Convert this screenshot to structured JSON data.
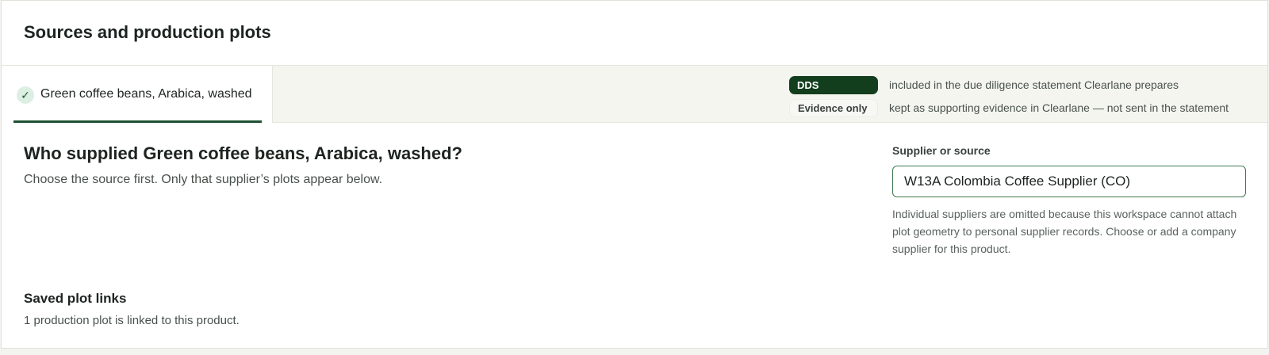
{
  "header": {
    "title": "Sources and production plots"
  },
  "product_tab": {
    "label": "Green coffee beans, Arabica, washed",
    "completed": true,
    "check_glyph": "✓"
  },
  "legend": {
    "dds": {
      "label": "DDS",
      "description": "included in the due diligence statement Clearlane prepares"
    },
    "evidence": {
      "label": "Evidence only",
      "description": "kept as supporting evidence in Clearlane — not sent in the statement"
    }
  },
  "source_section": {
    "question": "Who supplied Green coffee beans, Arabica, washed?",
    "hint": "Choose the source first. Only that supplier’s plots appear below.",
    "field_label": "Supplier or source",
    "field_value": "W13A Colombia Coffee Supplier (CO)",
    "help_text": "Individual suppliers are omitted because this workspace cannot attach plot geometry to personal supplier records. Choose or add a company supplier for this product."
  },
  "saved_links": {
    "title": "Saved plot links",
    "summary": "1 production plot is linked to this product."
  },
  "colors": {
    "accent_dark_green": "#133e1d",
    "tab_underline": "#1d5130",
    "input_border": "#3d7a50",
    "check_bg": "#dcefe2"
  },
  "icons": {
    "product_status": "check-icon"
  }
}
